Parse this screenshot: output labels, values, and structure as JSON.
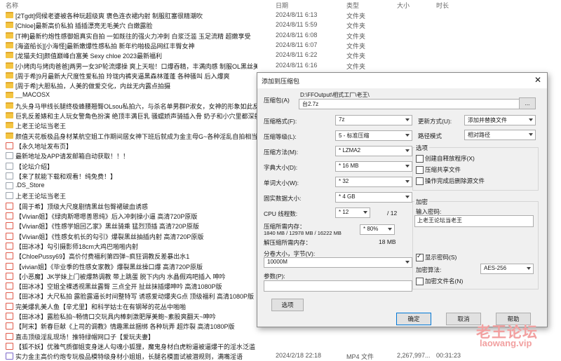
{
  "header": {
    "name": "名称",
    "date": "日期",
    "type": "类型",
    "size": "大小",
    "duration": "时长"
  },
  "files": [
    {
      "icon": "folder",
      "name": "[2Tgdt]伺候老婆被各种玩超级爽 褒色连衣裙内射 制服肛塞很精潮吹",
      "date": "2024/8/11 6:13",
      "type": "文件夹"
    },
    {
      "icon": "folder",
      "name": "[Chloe]最新高价私拍 插插漂亮无毛美穴 白嫩露脸",
      "date": "2024/8/11 5:59",
      "type": "文件夹"
    },
    {
      "icon": "folder",
      "name": "[T神]最新约炮性感御姐真实自拍 一如既往的强火力冲刺 白浆泛滥 玉足流精 超嫩享受",
      "date": "2024/8/11 6:08",
      "type": "文件夹"
    },
    {
      "icon": "folder",
      "name": "[海盗船长][小海怪]最新嫩爆性感私拍 新年约啪极品网红丰臀女神",
      "date": "2024/8/11 6:07",
      "type": "文件夹"
    },
    {
      "icon": "folder",
      "name": "[龙猫夫妇]颜值巅峰白富美 Sexy chloe  2023最新福利",
      "date": "2024/8/11 6:22",
      "type": "文件夹"
    },
    {
      "icon": "folder",
      "name": "[小烤肉与烤肉爸爸]两男一女3P轮流爆操 爽上天啦！口爆吞精，丰满肉感 制服OL黑丝美腿翘臀",
      "date": "2024/8/11 6:16",
      "type": "文件夹"
    },
    {
      "icon": "folder",
      "name": "[周于希]9月最新大尺度性爱私拍 玲珑内裤夹逼黑森林蓬蓬 各种骚叫 后入爆爽",
      "date": "",
      "type": ""
    },
    {
      "icon": "folder",
      "name": "[周于希]大胆私拍，人美的做爱交化，内丝无内露点拍摄",
      "date": "",
      "type": ""
    },
    {
      "icon": "folder",
      "name": "__MACOSX",
      "date": "",
      "type": ""
    },
    {
      "icon": "folder",
      "name": "九头身马甲线长腿终极蜂腰翘臀OLsou私拍六，与杀名单男群P淑女，女神的形象如此反差",
      "date": "",
      "type": ""
    },
    {
      "icon": "folder",
      "name": "巨乳反差婊和主人玩女警角色扮演 绝顶丰满巨乳 骚蠕娇声骑插入骨 奶子和小穴里都深射满精液",
      "date": "",
      "type": ""
    },
    {
      "icon": "folder",
      "name": "上老王论坛当老王",
      "date": "",
      "type": ""
    },
    {
      "icon": "folder",
      "name": "颜值天花板极品身材某航空姐工作期间居女神下班后就成为金主母G~各种淫乱自拍相当反差",
      "date": "",
      "type": ""
    },
    {
      "icon": "pdf",
      "name": "【永久地址发布页】",
      "date": "",
      "type": ""
    },
    {
      "icon": "file",
      "name": "最新地址及APP请发邮箱自动获取！！！",
      "date": "",
      "type": ""
    },
    {
      "icon": "file",
      "name": "【论坛介绍】",
      "date": "",
      "type": ""
    },
    {
      "icon": "file",
      "name": "【来了就能下载和观看！纯免费！】",
      "date": "",
      "type": ""
    },
    {
      "icon": "file",
      "name": ".DS_Store",
      "date": "",
      "type": ""
    },
    {
      "icon": "file",
      "name": "上老王论坛当老王",
      "date": "",
      "type": ""
    },
    {
      "icon": "pdf",
      "name": "【周于希】顶级大尺度剧情黑丝包臀裙破血诱惑",
      "date": "",
      "type": ""
    },
    {
      "icon": "pdf",
      "name": "【Vivian姐】《绿肉斯嗯嗯善恩纯》后入冲刺操小逼 高清720P原版",
      "date": "",
      "type": ""
    },
    {
      "icon": "pdf",
      "name": "【Vivian姐】《性感学姐回乙家》黑丝骑乘 猛烈顶插 高清720P原版",
      "date": "",
      "type": ""
    },
    {
      "icon": "pdf",
      "name": "【Vivian姐】《性感女机长的勾引》爆裂黑丝抽插内射 高清720P原版",
      "date": "",
      "type": ""
    },
    {
      "icon": "pdf",
      "name": "【田冰冰】勾引摄影师18cm大鸡巴啪啪内射",
      "date": "",
      "type": ""
    },
    {
      "icon": "pdf",
      "name": "【ChloePussy69】高价付费福利第四弹~疯狂调教反差暴出水1",
      "date": "",
      "type": ""
    },
    {
      "icon": "pdf",
      "name": "【vivian姐】《毕业季的性感女家教》爆裂黑丝操口爆 高清720P原版",
      "date": "",
      "type": ""
    },
    {
      "icon": "pdf",
      "name": "【小恶魔】JK学妹上门被爆熟调教 带上跳蛋 脱下内内 水晶假鸡吧插入 呻吟",
      "date": "",
      "type": ""
    },
    {
      "icon": "pdf",
      "name": "【田冰冰】空姐全裸透视黑丝露臀 三点全开 扯丝抹插爆呻吟 高清1080P版",
      "date": "",
      "type": ""
    },
    {
      "icon": "pdf",
      "name": "【田冰冰】大尺私拍 露脸露逼长时间整特写 诱惑爱动爆夹G点 顶级福利 高清1080P版",
      "date": "",
      "type": ""
    },
    {
      "icon": "pdf",
      "name": "完美爆乳美人鱼【辛尤里】和科学姑士在有钢琴的花丛中啪啪",
      "date": "",
      "type": ""
    },
    {
      "icon": "pdf",
      "name": "【田冰冰】露脸私拍~畅情口交玩具内棒刺激肥厚美鲍~素股爽翻天~呻吟",
      "date": "",
      "type": ""
    },
    {
      "icon": "pdf",
      "name": "【阿宋】新春巨献《上司的调教》情趣黑丝捆绑 各种玩弄 超炸裂 高清1080P版",
      "date": "",
      "type": ""
    },
    {
      "icon": "pdf",
      "name": "直击顶级淫乱现场！推特绿帽网口子【爱玩夫妻】",
      "date": "",
      "type": ""
    },
    {
      "icon": "pdf",
      "name": "【狐不妖】优雅气质御姐变身迷人勾魂小狐狸，魔鬼身材白虎粉逼被逼爆干的淫水泛滥",
      "date": "",
      "type": ""
    },
    {
      "icon": "mp4",
      "name": "实力金主高价约炮专玩极品模特级身材小姐姐，长腿名模面试被潜规则，满嘴淫语",
      "date": "2024/2/18 22:18",
      "type": "MP4 文件",
      "size": "2,267,997...",
      "duration": "00:31:23"
    }
  ],
  "dialog": {
    "title": "添加到压缩包",
    "close_glyph": "✕",
    "archive_label": "压缩包(A)",
    "archive_path": "D:\\FFOutput\\相式工厂\\老王\\",
    "archive_name": "台2.7z",
    "browse_label": "...",
    "format_label": "压缩格式(F):",
    "format_value": "7z",
    "level_label": "压缩等级(L):",
    "level_value": "5 - 标准压缩",
    "method_label": "压缩方法(M):",
    "method_value": "* LZMA2",
    "dict_label": "字典大小(D):",
    "dict_value": "* 16 MB",
    "word_label": "单词大小(W):",
    "word_value": "* 32",
    "solid_label": "固实数据大小:",
    "solid_value": "* 4 GB",
    "threads_label": "CPU 线程数:",
    "threads_value": "* 12",
    "threads_max": "/ 12",
    "mem_label": "压缩所需内存：",
    "mem_values": "1840 MB / 12978 MB / 16222 MB",
    "mem_percent": "* 80%",
    "decomp_label": "解压缩所需内存：",
    "decomp_value": "18 MB",
    "split_label": "分卷大小，字节(V):",
    "split_value": "10000M",
    "params_label": "参数(P):",
    "options_button": "选项",
    "update_label": "更新方式(U):",
    "update_value": "添加并替换文件",
    "path_label": "路径模式",
    "path_value": "相对路径",
    "options_group": "选项",
    "opt_sfx": "创建自释放程序(X)",
    "opt_shared": "压缩共享文件",
    "opt_delete": "操作完成后删除源文件",
    "encrypt_group": "加密",
    "password_label": "输入密码:",
    "password_value": "上老王论坛当老王",
    "show_password": "显示密码(S)",
    "enc_method_label": "加密算法:",
    "enc_method_value": "AES-256",
    "enc_filenames": "加密文件名(N)",
    "ok": "确定",
    "cancel": "取消",
    "help": "帮助"
  },
  "watermark": {
    "cn": "老王论坛",
    "url": "laowang.vip"
  },
  "colors": {
    "folder": "#f4c542",
    "accent": "#0078d7",
    "watermark": "#f2a0a0"
  }
}
